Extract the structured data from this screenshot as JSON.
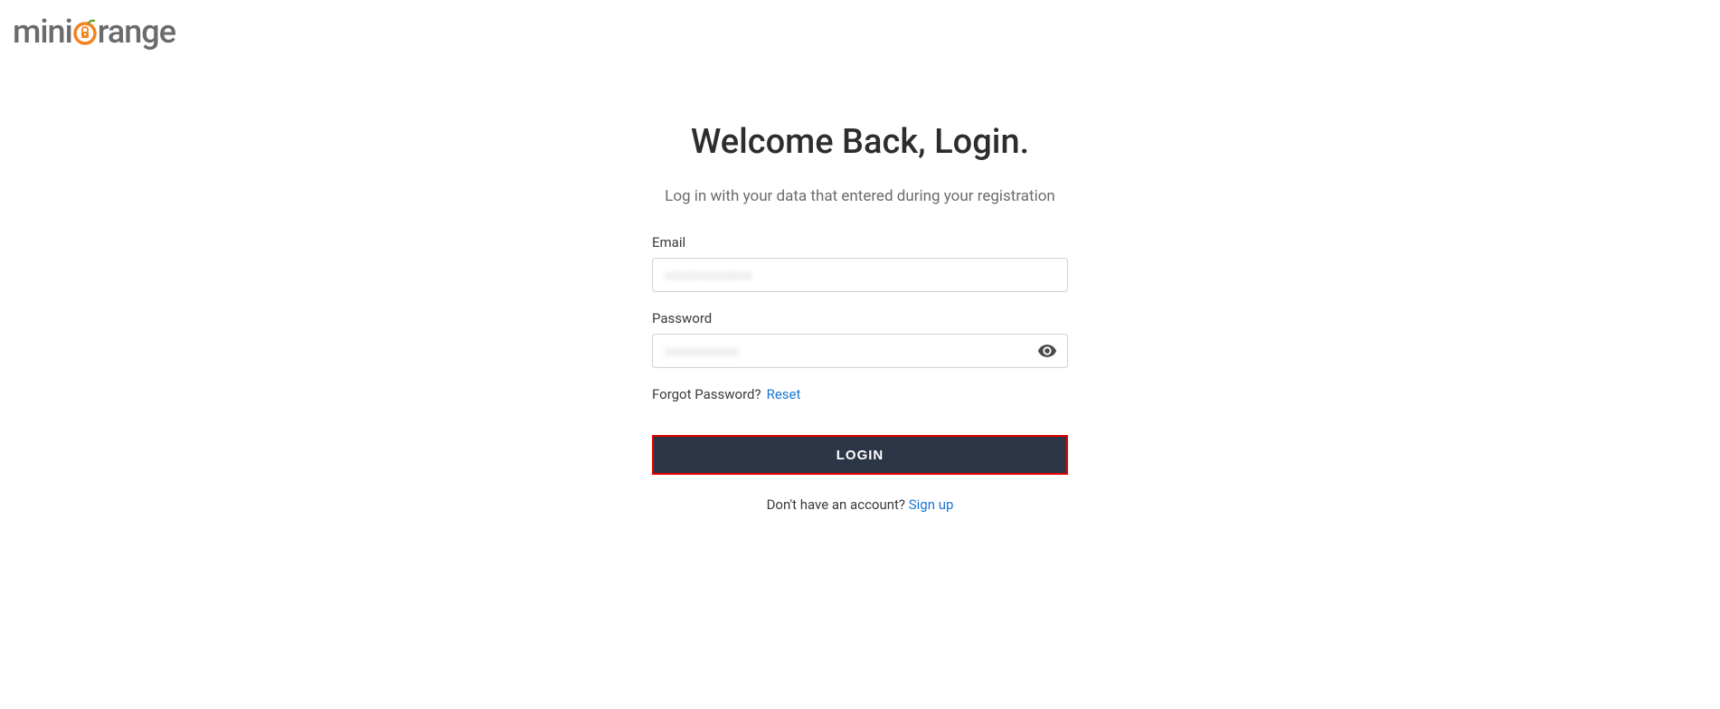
{
  "logo": {
    "text_before": "mini",
    "text_after": "range"
  },
  "login": {
    "title": "Welcome Back, Login.",
    "subtitle": "Log in with your data that entered during your registration",
    "email_label": "Email",
    "email_value": "",
    "password_label": "Password",
    "password_value": "",
    "forgot_text": "Forgot Password?",
    "reset_link": "Reset",
    "login_button": "LOGIN",
    "signup_text": "Don't have an account? ",
    "signup_link": "Sign up"
  }
}
